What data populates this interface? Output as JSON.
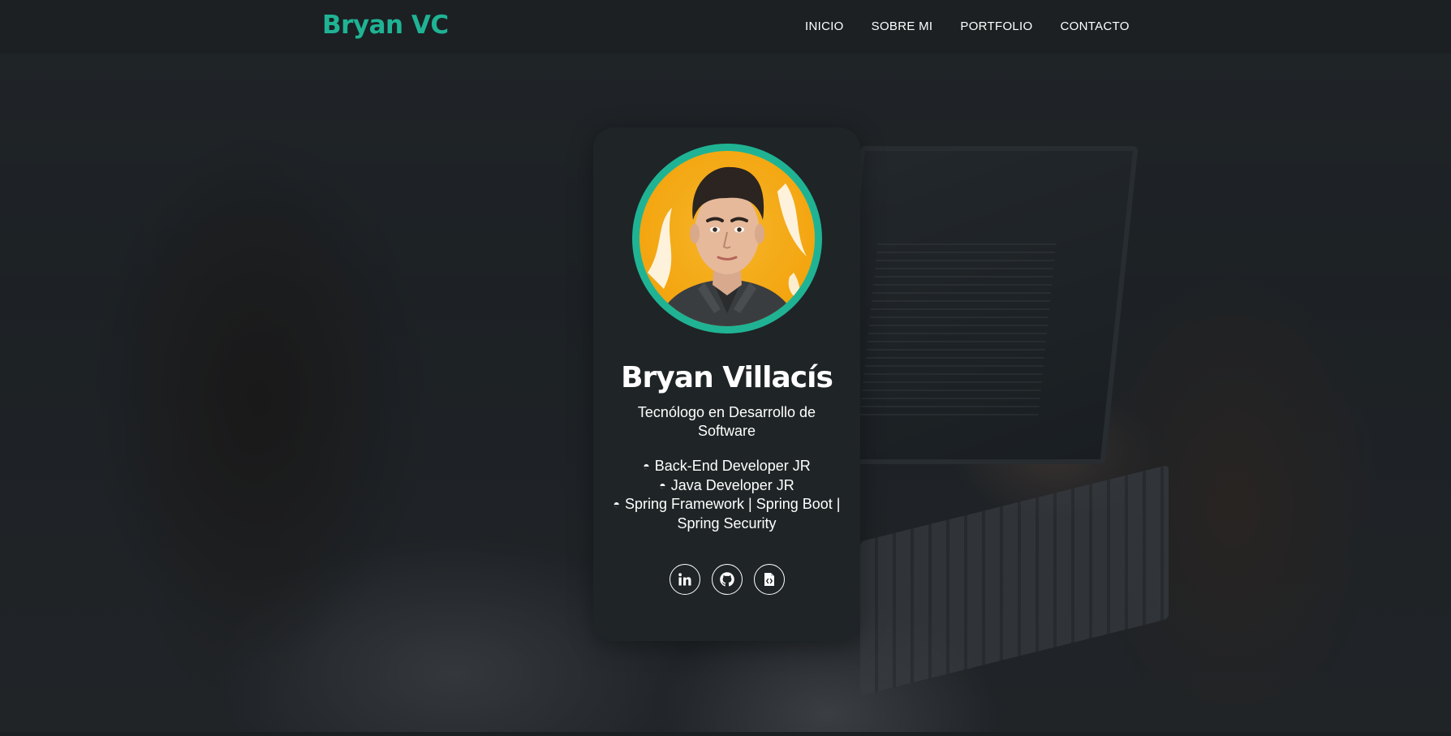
{
  "header": {
    "brand": "Bryan VC",
    "nav": [
      {
        "label": "INICIO"
      },
      {
        "label": "SOBRE MI"
      },
      {
        "label": "PORTFOLIO"
      },
      {
        "label": "CONTACTO"
      }
    ]
  },
  "profile": {
    "name": "Bryan Villacís",
    "subtitle": "Tecnólogo en Desarrollo de Software",
    "skills": [
      {
        "bullet": "◓",
        "text": "Back-End Developer JR"
      },
      {
        "bullet": "◓",
        "text": "Java Developer JR"
      },
      {
        "bullet": "◓",
        "text": "Spring Framework | Spring Boot | Spring Security"
      }
    ],
    "socials": [
      {
        "icon": "linkedin-icon"
      },
      {
        "icon": "github-icon"
      },
      {
        "icon": "code-file-icon"
      }
    ]
  },
  "colors": {
    "accent": "#1fb394",
    "background": "#1c2124",
    "card": "#1f2426",
    "text": "#ffffff",
    "avatar_bg": "#f3a50f"
  }
}
